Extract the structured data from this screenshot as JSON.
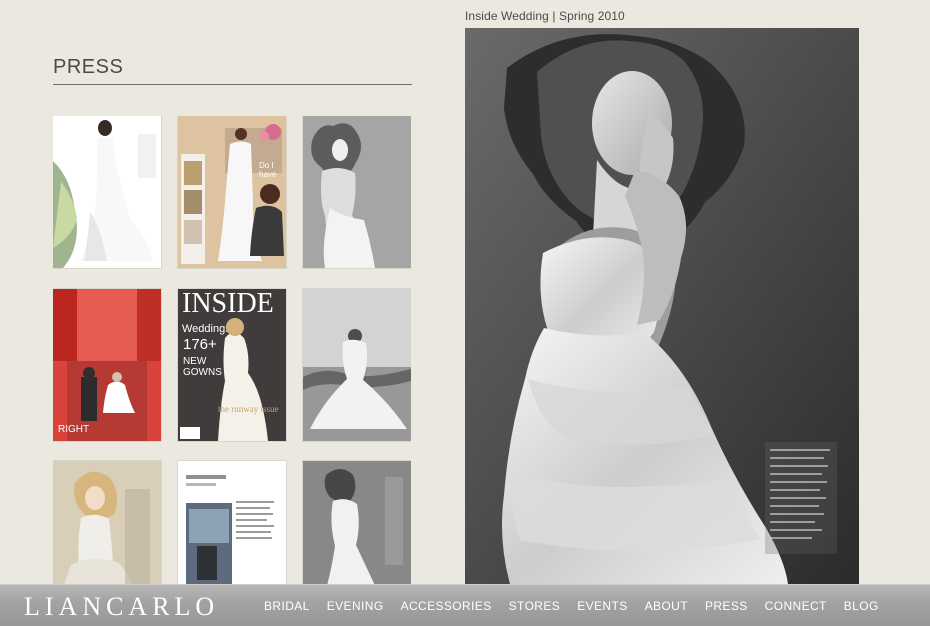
{
  "page": {
    "title": "PRESS",
    "caption": "Inside Wedding | Spring 2010"
  },
  "thumbnails": [
    {
      "row": 1,
      "col": 1
    },
    {
      "row": 1,
      "col": 2
    },
    {
      "row": 1,
      "col": 3
    },
    {
      "row": 2,
      "col": 1
    },
    {
      "row": 2,
      "col": 2
    },
    {
      "row": 2,
      "col": 3
    },
    {
      "row": 3,
      "col": 1
    },
    {
      "row": 3,
      "col": 2
    },
    {
      "row": 3,
      "col": 3
    }
  ],
  "footer": {
    "logo": "LIANCARLO",
    "nav": [
      {
        "label": "BRIDAL"
      },
      {
        "label": "EVENING"
      },
      {
        "label": "ACCESSORIES"
      },
      {
        "label": "STORES"
      },
      {
        "label": "EVENTS"
      },
      {
        "label": "ABOUT"
      },
      {
        "label": "PRESS"
      },
      {
        "label": "CONNECT"
      },
      {
        "label": "BLOG"
      }
    ]
  },
  "colors": {
    "page_bg": "#ebe8df",
    "footer_bg": "#a3a3a3",
    "title_text": "#4a4a4a",
    "footer_text": "#ffffff"
  }
}
